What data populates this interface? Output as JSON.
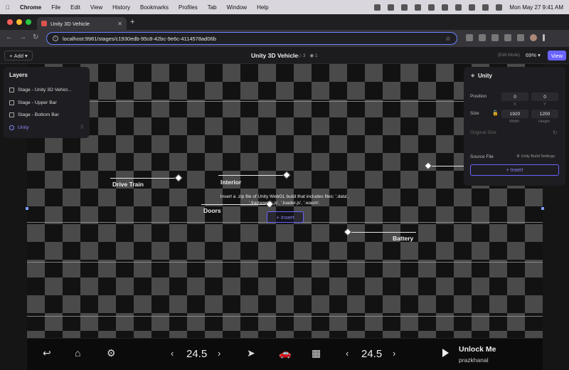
{
  "menubar": {
    "app": "Chrome",
    "items": [
      "File",
      "Edit",
      "View",
      "History",
      "Bookmarks",
      "Profiles",
      "Tab",
      "Window",
      "Help"
    ],
    "datetime": "Mon May 27  9:41 AM"
  },
  "browser": {
    "tab_title": "Unity 3D Vehicle",
    "url": "localhost:9981/stages/c1930edb-95c8-42bc-9e6c-4114578ad06b"
  },
  "header": {
    "add_label": "Add",
    "title": "Unity 3D Vehicle",
    "badge_a": "3",
    "badge_b": "1",
    "edit_mode": "(Edit Mode)",
    "zoom": "69%",
    "view_label": "View"
  },
  "layers": {
    "title": "Layers",
    "items": [
      {
        "label": "Stage - Unity 3D Vehicl..."
      },
      {
        "label": "Stage - Upper Bar"
      },
      {
        "label": "Stage - Bottom Bar"
      },
      {
        "label": "Unity"
      }
    ]
  },
  "canvas": {
    "callouts": {
      "drive_train": "Drive Train",
      "interior": "Interior",
      "doors": "Doors",
      "battery": "Battery"
    },
    "insert_message": "Insert a .zip file of Unity WebGL build that includes files: '.data', '.framework.js', '.loader.js', '.wasm'.",
    "insert_label": "+ Insert"
  },
  "properties": {
    "title": "Unity",
    "position_label": "Position",
    "pos_x": "0",
    "pos_y": "0",
    "x_label": "X",
    "y_label": "Y",
    "size_label": "Size",
    "width": "1920",
    "height": "1200",
    "width_label": "Width",
    "height_label": "Height",
    "original_size_label": "Original Size",
    "source_file_label": "Source File",
    "build_settings_label": "Unity Build Settings",
    "insert_label": "+ Insert"
  },
  "carbar": {
    "temp_left": "24.5",
    "temp_right": "24.5",
    "unlock_label": "Unlock Me",
    "username": "prazkhanal"
  },
  "colors": {
    "accent": "#6a63ff",
    "url_focus": "#6a84ff"
  }
}
